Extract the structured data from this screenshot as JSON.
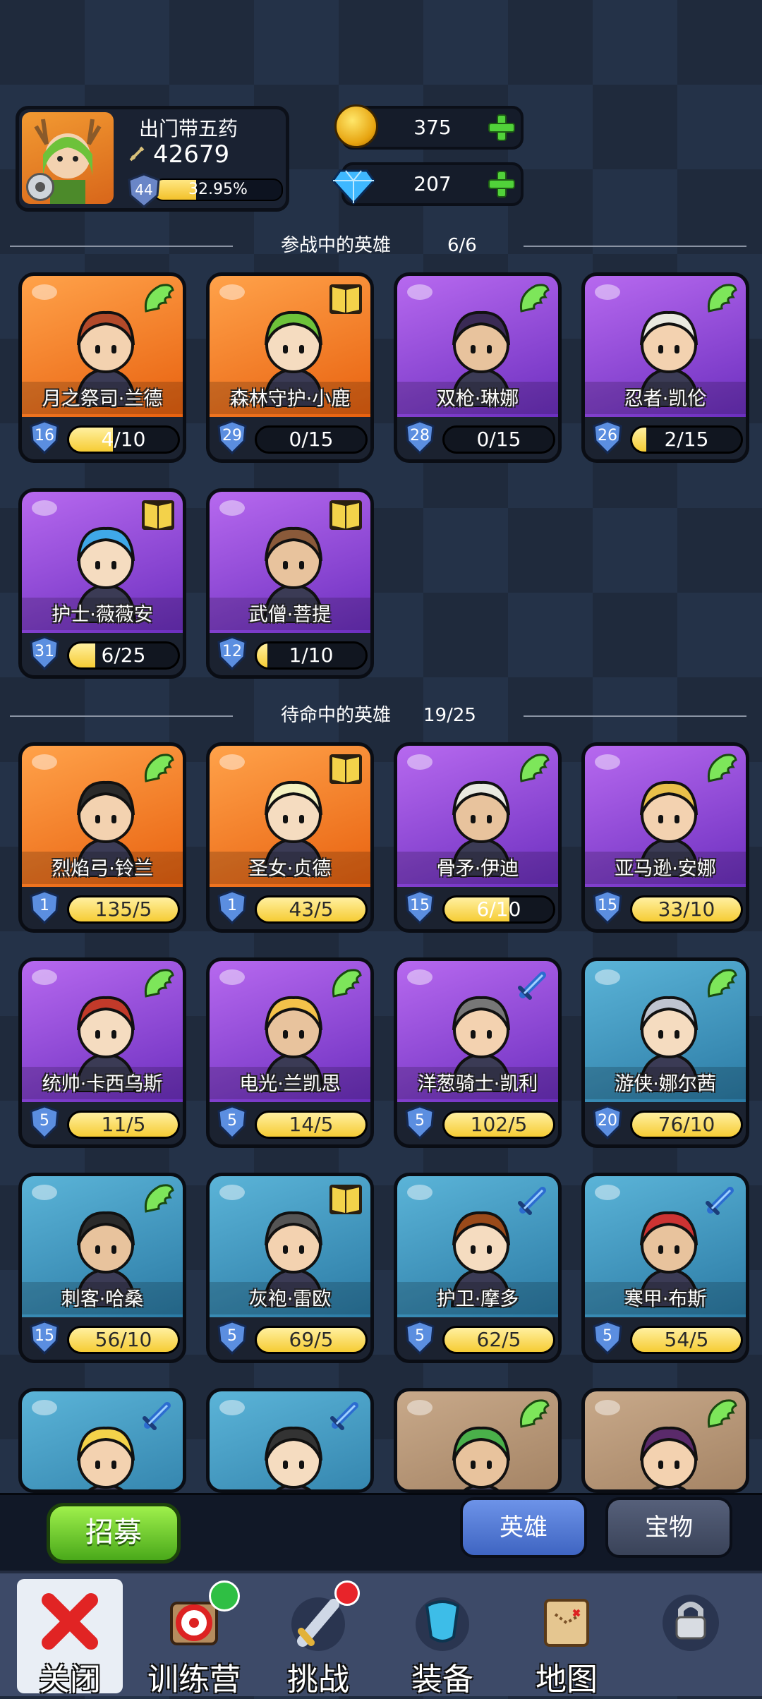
{
  "player": {
    "name": "出门带五药",
    "power": "42679",
    "level": "44",
    "xp_text": "32.95%",
    "xp_fraction": 0.3295
  },
  "currency": {
    "gold": "375",
    "gems": "207"
  },
  "active_section": {
    "title": "参战中的英雄",
    "count": "6/6"
  },
  "bench_section": {
    "title": "待命中的英雄",
    "count": "19/25"
  },
  "heroes": [
    {
      "name": "月之祭司·兰德",
      "level": "16",
      "progress": "4/10",
      "fill": 0.4,
      "bg": "orange",
      "class_icon": "wing-icon"
    },
    {
      "name": "森林守护·小鹿",
      "level": "29",
      "progress": "0/15",
      "fill": 0,
      "bg": "orange",
      "class_icon": "book-icon"
    },
    {
      "name": "双枪·琳娜",
      "level": "28",
      "progress": "0/15",
      "fill": 0,
      "bg": "purple",
      "class_icon": "wing-icon"
    },
    {
      "name": "忍者·凯伦",
      "level": "26",
      "progress": "2/15",
      "fill": 0.13,
      "bg": "purple",
      "class_icon": "wing-icon"
    },
    {
      "name": "护士·薇薇安",
      "level": "31",
      "progress": "6/25",
      "fill": 0.24,
      "bg": "purple",
      "class_icon": "book-icon"
    },
    {
      "name": "武僧·菩提",
      "level": "12",
      "progress": "1/10",
      "fill": 0.1,
      "bg": "purple",
      "class_icon": "book-icon"
    },
    {
      "name": "烈焰弓·铃兰",
      "level": "1",
      "progress": "135/5",
      "fill": 1,
      "bg": "orange",
      "class_icon": "wing-icon"
    },
    {
      "name": "圣女·贞德",
      "level": "1",
      "progress": "43/5",
      "fill": 1,
      "bg": "orange",
      "class_icon": "book-icon"
    },
    {
      "name": "骨矛·伊迪",
      "level": "15",
      "progress": "6/10",
      "fill": 0.6,
      "bg": "purple",
      "class_icon": "wing-icon"
    },
    {
      "name": "亚马逊·安娜",
      "level": "15",
      "progress": "33/10",
      "fill": 1,
      "bg": "purple",
      "class_icon": "wing-icon"
    },
    {
      "name": "统帅·卡西乌斯",
      "level": "5",
      "progress": "11/5",
      "fill": 1,
      "bg": "purple",
      "class_icon": "wing-icon"
    },
    {
      "name": "电光·兰凯思",
      "level": "5",
      "progress": "14/5",
      "fill": 1,
      "bg": "purple",
      "class_icon": "wing-icon"
    },
    {
      "name": "洋葱骑士·凯利",
      "level": "5",
      "progress": "102/5",
      "fill": 1,
      "bg": "purple",
      "class_icon": "sword-icon"
    },
    {
      "name": "游侠·娜尔茜",
      "level": "20",
      "progress": "76/10",
      "fill": 1,
      "bg": "teal",
      "class_icon": "wing-icon"
    },
    {
      "name": "刺客·哈桑",
      "level": "15",
      "progress": "56/10",
      "fill": 1,
      "bg": "teal",
      "class_icon": "wing-icon"
    },
    {
      "name": "灰袍·雷欧",
      "level": "5",
      "progress": "69/5",
      "fill": 1,
      "bg": "teal",
      "class_icon": "book-icon"
    },
    {
      "name": "护卫·摩多",
      "level": "5",
      "progress": "62/5",
      "fill": 1,
      "bg": "teal",
      "class_icon": "sword-icon"
    },
    {
      "name": "寒甲·布斯",
      "level": "5",
      "progress": "54/5",
      "fill": 1,
      "bg": "teal",
      "class_icon": "sword-icon"
    },
    {
      "name": "",
      "level": "",
      "progress": "",
      "fill": 0,
      "bg": "teal",
      "class_icon": "sword-icon"
    },
    {
      "name": "",
      "level": "",
      "progress": "",
      "fill": 0,
      "bg": "teal",
      "class_icon": "sword-icon"
    },
    {
      "name": "",
      "level": "",
      "progress": "",
      "fill": 0,
      "bg": "tan",
      "class_icon": "wing-icon"
    },
    {
      "name": "",
      "level": "",
      "progress": "",
      "fill": 0,
      "bg": "tan",
      "class_icon": "wing-icon"
    }
  ],
  "recruit_label": "招募",
  "tabs": {
    "heroes": "英雄",
    "treasures": "宝物"
  },
  "nav": {
    "close": "关闭",
    "training": "训练营",
    "challenge": "挑战",
    "equipment": "装备",
    "map": "地图"
  }
}
